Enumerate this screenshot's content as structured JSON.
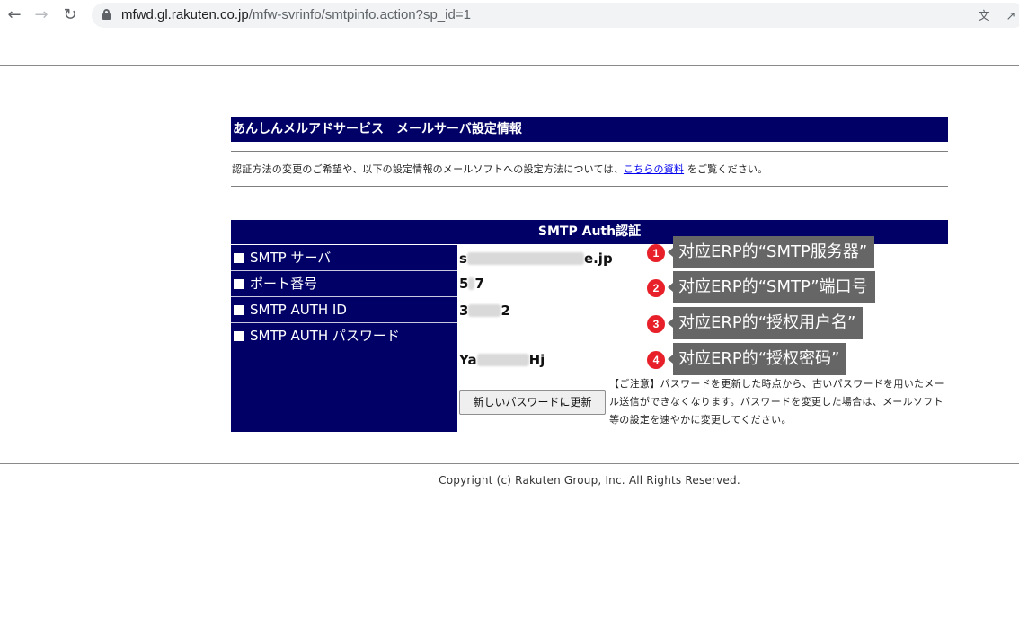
{
  "browser": {
    "url_host": "mfwd.gl.rakuten.co.jp",
    "url_path": "/mfw-svrinfo/smtpinfo.action?sp_id=1"
  },
  "header": {
    "title": "あんしんメルアドサービス　メールサーバ設定情報",
    "notice_before": "認証方法の変更のご希望や、以下の設定情報のメールソフトへの設定方法については、",
    "notice_link": "こちらの資料",
    "notice_after": " をご覧ください。"
  },
  "smtp": {
    "section_title": "SMTP Auth認証",
    "rows": [
      {
        "label": "SMTP サーバ",
        "value_start": "s",
        "value_end": "e.jp"
      },
      {
        "label": "ポート番号",
        "value_start": "5",
        "value_end": "7"
      },
      {
        "label": "SMTP AUTH ID",
        "value_start": "3",
        "value_end": "2"
      },
      {
        "label": "SMTP AUTH パスワード",
        "value_start": "Ya",
        "value_end": "Hj"
      }
    ],
    "update_button": "新しいパスワードに更新",
    "caution": "【ご注意】パスワードを更新した時点から、古いパスワードを用いたメール送信ができなくなります。パスワードを変更した場合は、メールソフト等の設定を速やかに変更してください。"
  },
  "annotations": [
    {
      "num": "1",
      "text": "对应ERP的“SMTP服务器”"
    },
    {
      "num": "2",
      "text": "对应ERP的“SMTP”端口号"
    },
    {
      "num": "3",
      "text": "对应ERP的“授权用户名”"
    },
    {
      "num": "4",
      "text": "对应ERP的“授权密码”"
    }
  ],
  "footer": {
    "copyright": "Copyright (c) Rakuten Group, Inc. All Rights Reserved."
  },
  "icons": {
    "back": "back-arrow-icon",
    "forward": "forward-arrow-icon",
    "reload": "reload-icon",
    "lock": "lock-icon",
    "translate": "translate-icon",
    "share": "share-icon"
  },
  "colors": {
    "navy": "#000066",
    "annotation_bg": "#666666",
    "annotation_dot": "#e8202a",
    "link": "#0000ee"
  }
}
